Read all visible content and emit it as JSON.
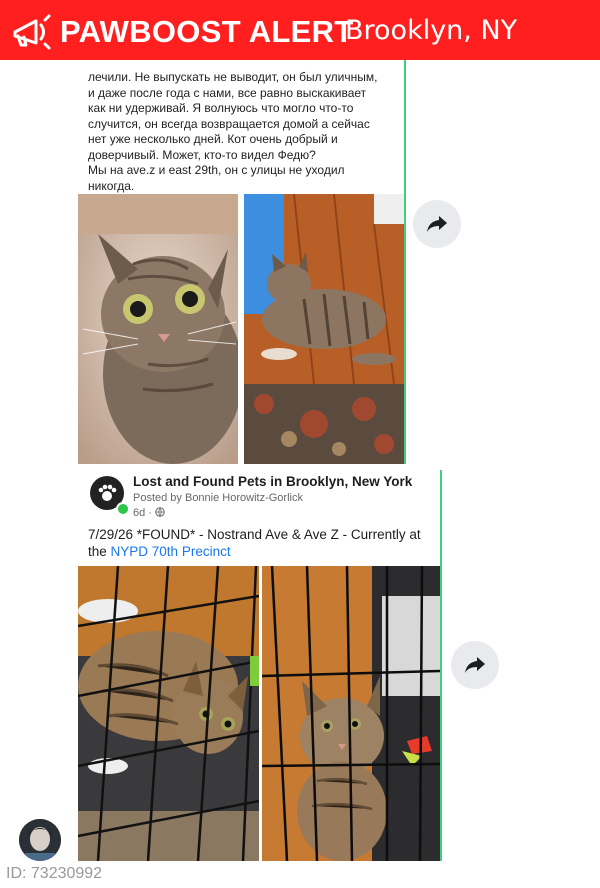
{
  "header": {
    "brand": "PAWBOOST ALERT",
    "location": "Brooklyn, NY",
    "background": "#ff1f1f"
  },
  "post1": {
    "text": "лечили. Не выпускать не выводит, он был уличным,\nи даже после года с нами, все равно выскакивает\nкак ни удерживай. Я волнуюсь что могло что-то\nслучится, он всегда возвращается домой а сейчас\nнет уже несколько дней. Кот очень добрый и\nдоверчивый. Может, кто-то видел Федю?\nМы на ave.z и east 29th, он с улицы не уходил\nникогда.",
    "photos": [
      "cat-looking-up-photo",
      "cat-lying-on-floor-photo"
    ]
  },
  "post2": {
    "group_name": "Lost and Found Pets in Brooklyn, New York",
    "posted_by": "Posted by Bonnie Horowitz-Gorlick",
    "age": "6d · ",
    "text": "7/29/26 *FOUND* - Nostrand Ave & Ave Z - Currently at the ",
    "link_text": "NYPD 70th Precinct",
    "photos": [
      "cat-in-cage-photo-1",
      "cat-in-cage-photo-2"
    ]
  },
  "share_icon": "share-arrow-icon",
  "footer": {
    "id_text": "ID: 73230992"
  }
}
